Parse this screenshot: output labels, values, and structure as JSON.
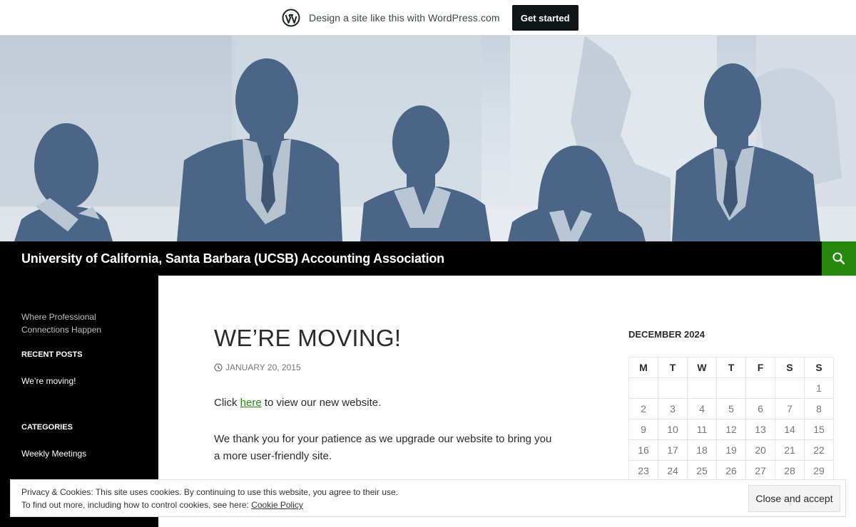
{
  "wp_banner": {
    "text": "Design a site like this with WordPress.com",
    "button_label": "Get started"
  },
  "site": {
    "title": "University of California, Santa Barbara (UCSB) Accounting Association",
    "tagline": "Where Professional Connections Happen"
  },
  "sidebar": {
    "recent_posts_title": "RECENT POSTS",
    "recent_posts": [
      "We’re moving!"
    ],
    "categories_title": "CATEGORIES",
    "categories": [
      "Weekly Meetings"
    ]
  },
  "post": {
    "title": "WE’RE MOVING!",
    "date": "JANUARY 20, 2015",
    "p1_before": "Click ",
    "p1_link": "here",
    "p1_after": " to view our new website.",
    "p2": "We thank you for your patience as we upgrade our website to bring you a more user-friendly site."
  },
  "calendar": {
    "caption": "DECEMBER 2024",
    "days": [
      "M",
      "T",
      "W",
      "T",
      "F",
      "S",
      "S"
    ],
    "weeks": [
      [
        "",
        "",
        "",
        "",
        "",
        "",
        "1"
      ],
      [
        "2",
        "3",
        "4",
        "5",
        "6",
        "7",
        "8"
      ],
      [
        "9",
        "10",
        "11",
        "12",
        "13",
        "14",
        "15"
      ],
      [
        "16",
        "17",
        "18",
        "19",
        "20",
        "21",
        "22"
      ],
      [
        "23",
        "24",
        "25",
        "26",
        "27",
        "28",
        "29"
      ]
    ]
  },
  "cookie": {
    "line1": "Privacy & Cookies: This site uses cookies. By continuing to use this website, you agree to their use.",
    "line2_prefix": "To find out more, including how to control cookies, see here: ",
    "line2_link": "Cookie Policy",
    "button_label": "Close and accept"
  },
  "colors": {
    "accent_green": "#24890d",
    "header_black": "#000000",
    "silhouette": "#4a6585"
  },
  "icons": {
    "wp_logo": "wordpress-logo-icon",
    "search": "search-icon",
    "date": "clock-icon"
  }
}
